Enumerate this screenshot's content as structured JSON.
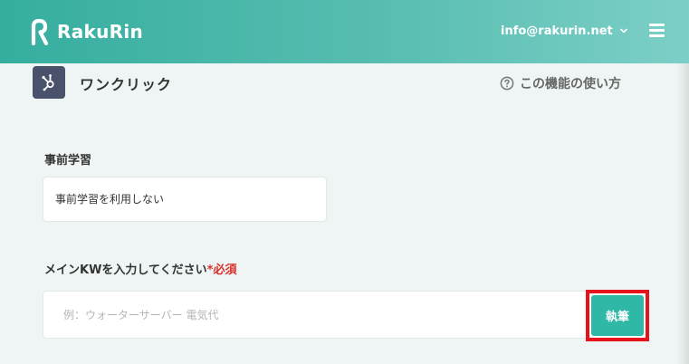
{
  "header": {
    "brand": "RakuRin",
    "account_email": "info@rakurin.net",
    "logo_icon": "rakurin-r-logo",
    "menu_icon": "hamburger-icon",
    "account_icon": "chevron-down-icon"
  },
  "tool": {
    "icon": "one-click-icon",
    "title": "ワンクリック",
    "help_label": "この機能の使い方",
    "help_icon": "question-circle-icon"
  },
  "form": {
    "prelearn_label": "事前学習",
    "prelearn_value": "事前学習を利用しない",
    "kw_label": "メインKWを入力してください",
    "kw_required": "*必須",
    "kw_placeholder": "例：ウォーターサーバー 電気代",
    "kw_value": "",
    "submit_label": "執筆"
  },
  "colors": {
    "header_gradient_start": "#35ae9f",
    "header_gradient_end": "#7ccfc6",
    "page_background": "#eef5f4",
    "accent": "#2fb8a6",
    "required": "#d9302c",
    "highlight_outline": "#e5141c",
    "tool_icon_background": "#49526a"
  }
}
